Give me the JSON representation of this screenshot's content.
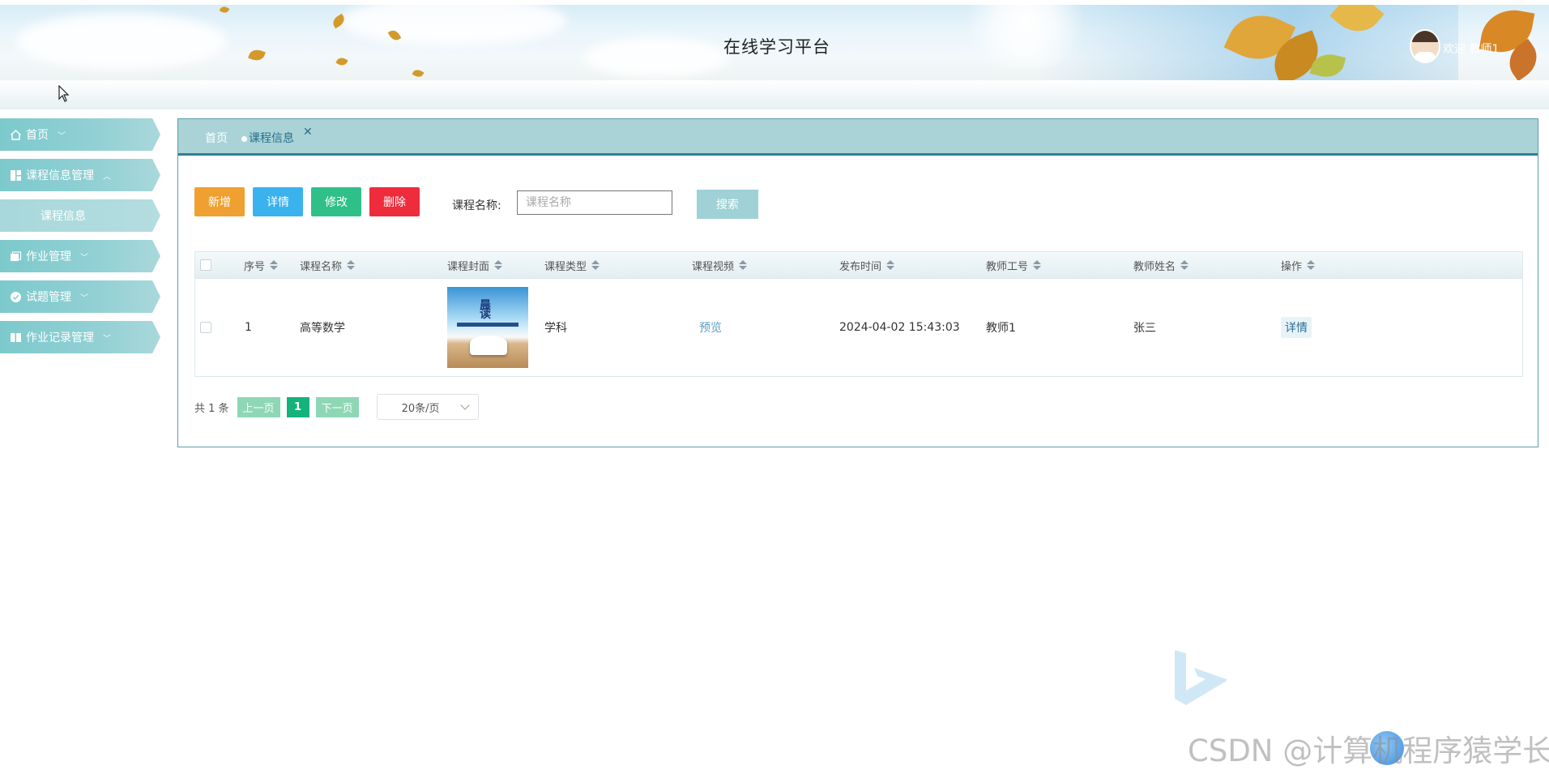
{
  "header": {
    "title": "在线学习平台",
    "welcome": "欢迎 教师1"
  },
  "sidebar": {
    "items": [
      {
        "label": "首页",
        "icon": "home-icon",
        "chevron": "﹀"
      },
      {
        "label": "课程信息管理",
        "icon": "grid-icon",
        "chevron": "︿"
      },
      {
        "label": "课程信息",
        "icon": "",
        "chevron": ""
      },
      {
        "label": "作业管理",
        "icon": "folder-icon",
        "chevron": "﹀"
      },
      {
        "label": "试题管理",
        "icon": "check-circle-icon",
        "chevron": "﹀"
      },
      {
        "label": "作业记录管理",
        "icon": "book-icon",
        "chevron": "﹀"
      }
    ]
  },
  "tabs": {
    "home": "首页",
    "active": "课程信息",
    "close": "✕"
  },
  "toolbar": {
    "add": "新增",
    "detail": "详情",
    "edit": "修改",
    "delete": "删除",
    "search_label": "课程名称:",
    "search_placeholder": "课程名称",
    "search_button": "搜索"
  },
  "table": {
    "headers": [
      "序号",
      "课程名称",
      "课程封面",
      "课程类型",
      "课程视频",
      "发布时间",
      "教师工号",
      "教师姓名",
      "操作"
    ],
    "rows": [
      {
        "index": "1",
        "name": "高等数学",
        "cover_text": "晨读",
        "type": "学科",
        "video": "预览",
        "time": "2024-04-02 15:43:03",
        "teacher_id": "教师1",
        "teacher_name": "张三",
        "action": "详情"
      }
    ]
  },
  "pagination": {
    "total": "共 1 条",
    "prev": "上一页",
    "current": "1",
    "next": "下一页",
    "page_size": "20条/页"
  },
  "watermark": "CSDN @计算机程序猿学长",
  "colors": {
    "sidebar": "#8ecfd3",
    "tabbar": "#a9d3d7",
    "add": "#f0a030",
    "detail": "#3ab2ee",
    "edit": "#2fc08a",
    "delete": "#ef2c3c",
    "pager_current": "#14b37c"
  }
}
